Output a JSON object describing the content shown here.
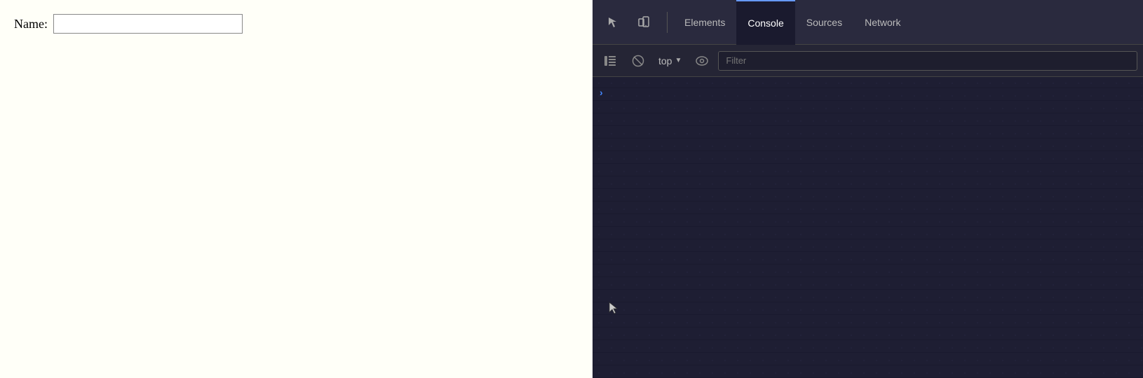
{
  "webpage": {
    "label": "Name:",
    "input_placeholder": "",
    "background": "#fffff8"
  },
  "devtools": {
    "tabs": [
      {
        "id": "elements",
        "label": "Elements",
        "active": false
      },
      {
        "id": "console",
        "label": "Console",
        "active": true
      },
      {
        "id": "sources",
        "label": "Sources",
        "active": false
      },
      {
        "id": "network",
        "label": "Network",
        "active": false
      }
    ],
    "toolbar": {
      "context_label": "top",
      "filter_placeholder": "Filter"
    },
    "console_area": {
      "chevron": "›"
    },
    "icons": {
      "inspect": "inspect-icon",
      "device": "device-icon",
      "sidebar": "sidebar-icon",
      "clear": "clear-icon",
      "eye": "eye-icon"
    }
  }
}
